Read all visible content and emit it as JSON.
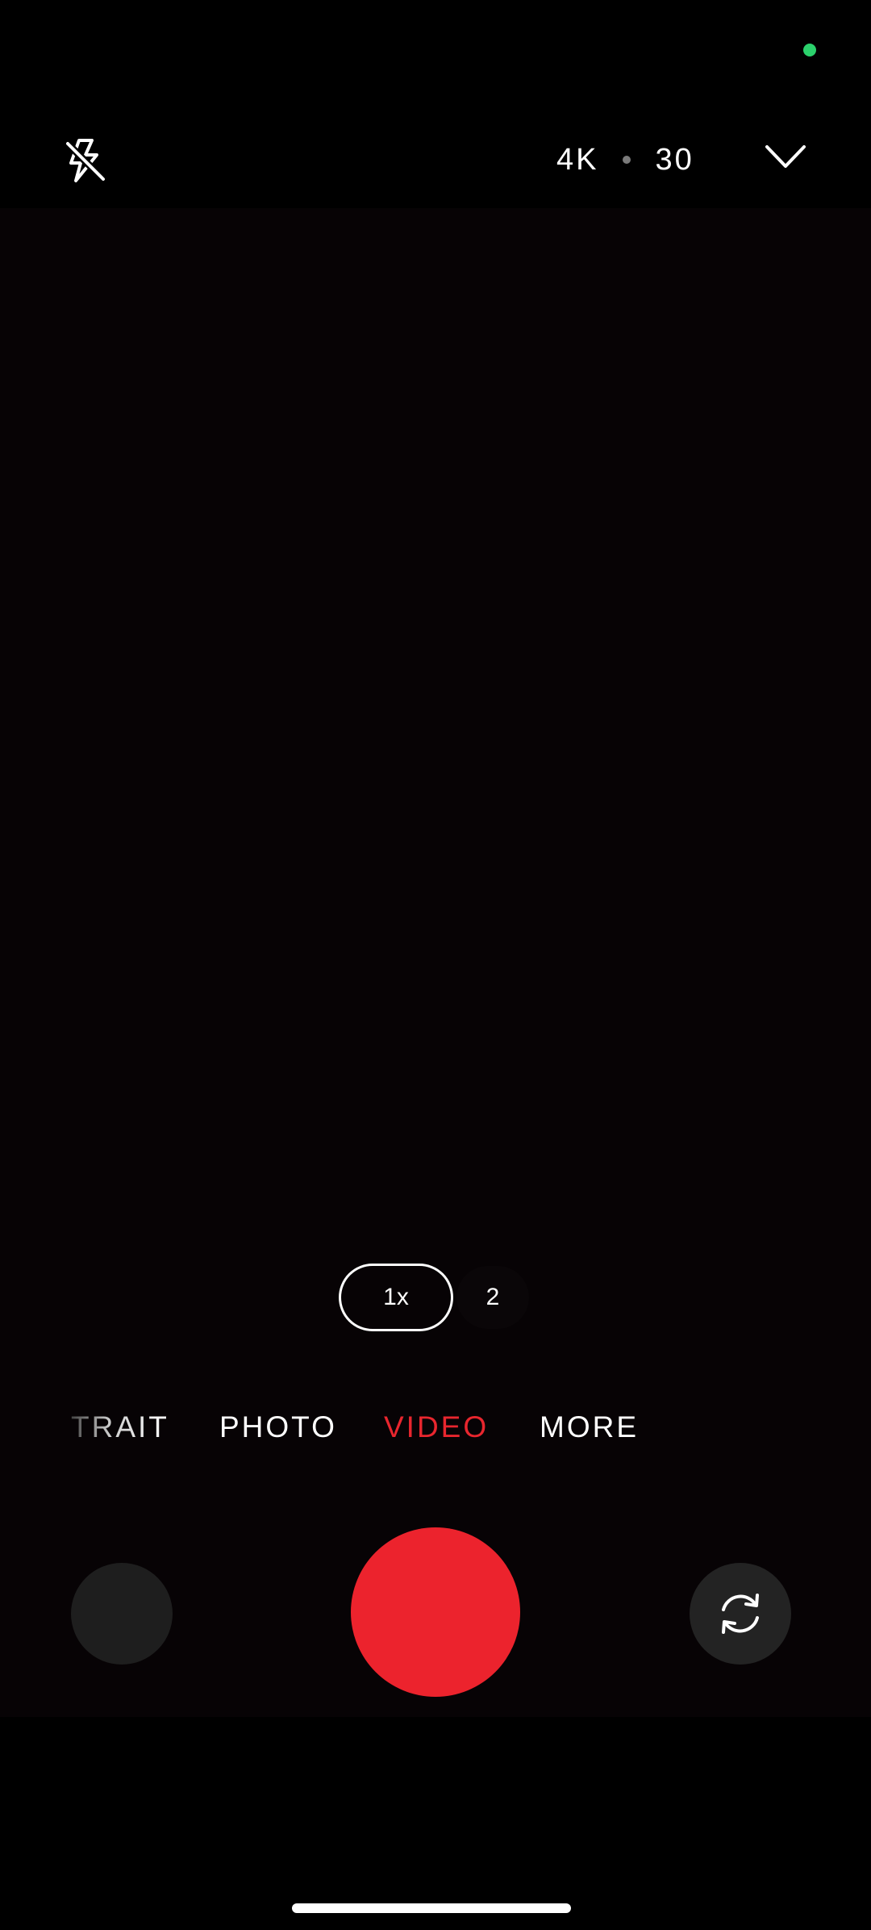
{
  "status": {
    "privacy_indicator_color": "#2bd16c"
  },
  "top_bar": {
    "flash_icon": "flash-off-icon",
    "resolution": "4K",
    "frame_rate": "30",
    "expand_icon": "chevron-down-icon"
  },
  "zoom": {
    "active": "1x",
    "alternate": "2"
  },
  "modes": {
    "items": [
      "TRAIT",
      "PHOTO",
      "VIDEO",
      "MORE"
    ],
    "selected": "VIDEO",
    "selected_color": "#e8262e"
  },
  "controls": {
    "gallery_icon": "gallery-thumbnail",
    "shutter_color": "#ec232d",
    "switch_icon": "switch-camera-icon"
  }
}
